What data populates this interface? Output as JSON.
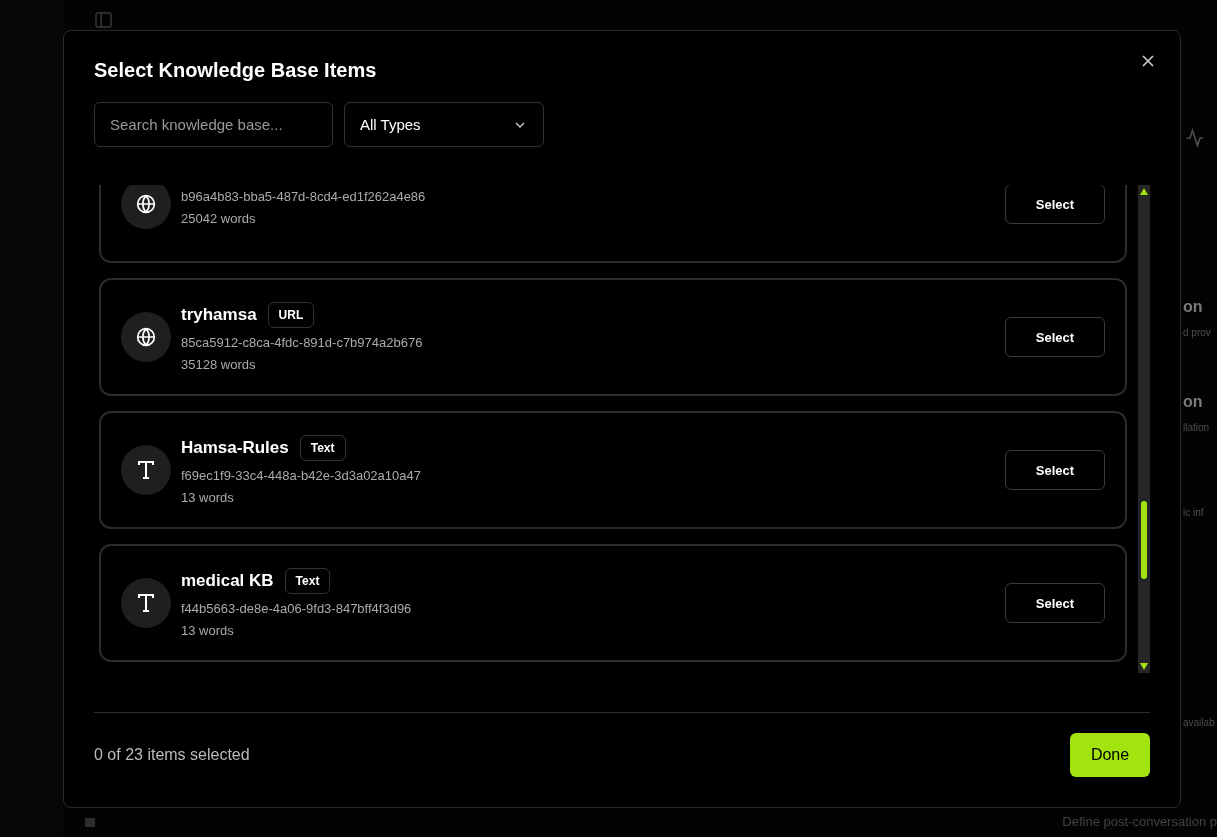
{
  "background": {
    "fragments": [
      {
        "kind": "title",
        "text": "on"
      },
      {
        "kind": "desc",
        "text": "d prov"
      },
      {
        "kind": "title",
        "text": "on"
      },
      {
        "kind": "desc",
        "text": "llation"
      },
      {
        "kind": "desc",
        "text": "ic inf"
      },
      {
        "kind": "desc",
        "text": "availab"
      }
    ],
    "bottom_text": "Define post-conversation p"
  },
  "dialog": {
    "title": "Select Knowledge Base Items",
    "search": {
      "placeholder": "Search knowledge base..."
    },
    "type_filter": {
      "value": "All Types"
    },
    "items": [
      {
        "kind": "url",
        "id": "b96a4b83-bba5-487d-8cd4-ed1f262a4e86",
        "words": "25042 words",
        "action": "Select"
      },
      {
        "kind": "url",
        "name": "tryhamsa",
        "badge": "URL",
        "id": "85ca5912-c8ca-4fdc-891d-c7b974a2b676",
        "words": "35128 words",
        "action": "Select"
      },
      {
        "kind": "text",
        "name": "Hamsa-Rules",
        "badge": "Text",
        "id": "f69ec1f9-33c4-448a-b42e-3d3a02a10a47",
        "words": "13 words",
        "action": "Select"
      },
      {
        "kind": "text",
        "name": "medical KB",
        "badge": "Text",
        "id": "f44b5663-de8e-4a06-9fd3-847bff4f3d96",
        "words": "13 words",
        "action": "Select"
      }
    ],
    "footer": {
      "status": "0 of 23 items selected",
      "done": "Done"
    }
  }
}
